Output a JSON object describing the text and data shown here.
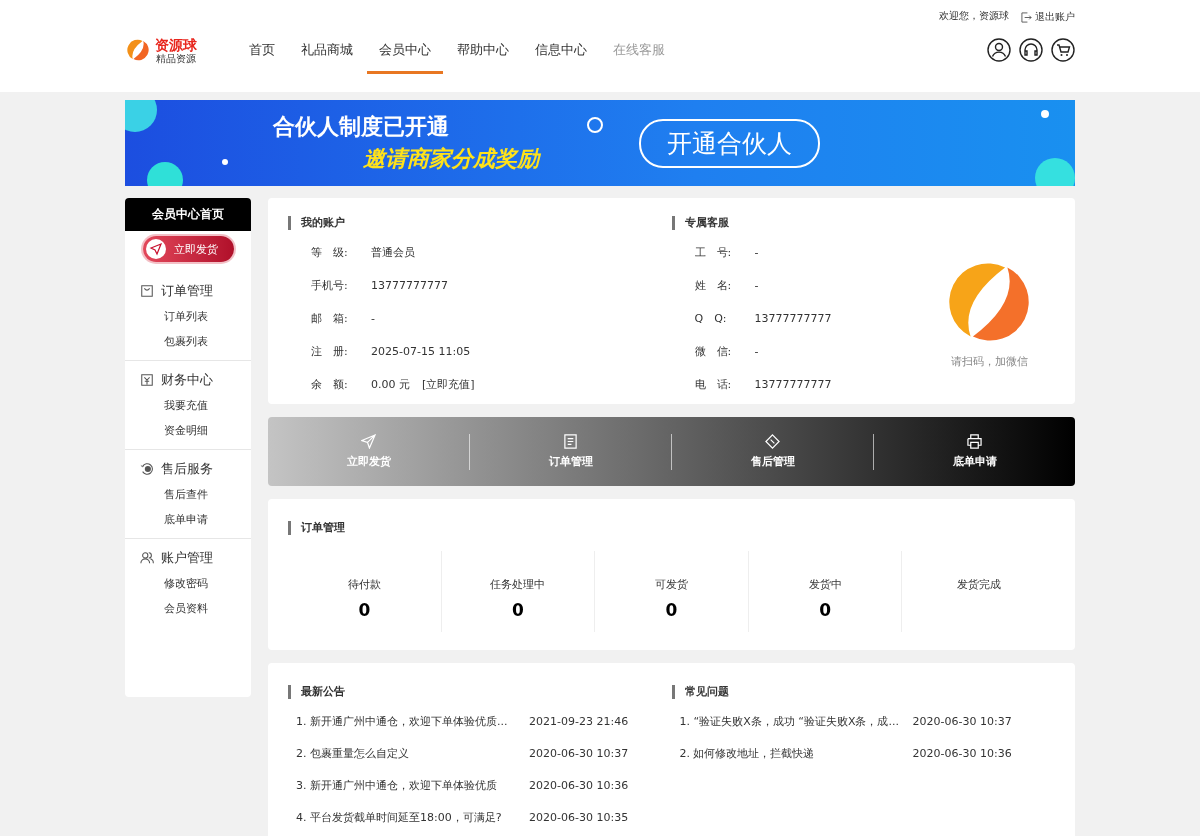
{
  "topbar": {
    "welcome": "欢迎您，资源球",
    "logout": "退出账户"
  },
  "logo": {
    "name": "资源球",
    "tagline": "精品资源"
  },
  "nav": [
    {
      "label": "首页",
      "selected": false,
      "disabled": false
    },
    {
      "label": "礼品商城",
      "selected": false,
      "disabled": false
    },
    {
      "label": "会员中心",
      "selected": true,
      "disabled": false
    },
    {
      "label": "帮助中心",
      "selected": false,
      "disabled": false
    },
    {
      "label": "信息中心",
      "selected": false,
      "disabled": false
    },
    {
      "label": "在线客服",
      "selected": false,
      "disabled": true
    }
  ],
  "banner": {
    "title": "合伙人制度已开通",
    "subtitle": "邀请商家分成奖励",
    "button": "开通合伙人"
  },
  "sidebar": {
    "home": "会员中心首页",
    "ship_button": "立即发货",
    "groups": [
      {
        "kind": "bag",
        "title": "订单管理",
        "items": [
          "订单列表",
          "包裹列表"
        ]
      },
      {
        "kind": "money",
        "title": "财务中心",
        "items": [
          "我要充值",
          "资金明细"
        ]
      },
      {
        "kind": "service",
        "title": "售后服务",
        "items": [
          "售后查件",
          "底单申请"
        ]
      },
      {
        "kind": "users",
        "title": "账户管理",
        "items": [
          "修改密码",
          "会员资料"
        ]
      }
    ]
  },
  "account": {
    "title": "我的账户",
    "rows": [
      {
        "label": "等　级:",
        "value": "普通会员"
      },
      {
        "label": "手机号:",
        "value": "13777777777"
      },
      {
        "label": "邮　箱:",
        "value": "-"
      },
      {
        "label": "注　册:",
        "value": "2025-07-15 11:05"
      },
      {
        "label": "余　额:",
        "value": "0.00 元",
        "link": "[立即充值]"
      }
    ]
  },
  "service": {
    "title": "专属客服",
    "rows": [
      {
        "label": "工　号:",
        "value": "-"
      },
      {
        "label": "姓　名:",
        "value": "-"
      },
      {
        "label": "Q　Q:",
        "value": "13777777777"
      },
      {
        "label": "微　信:",
        "value": "-"
      },
      {
        "label": "电　话:",
        "value": "13777777777"
      }
    ],
    "qr_caption": "请扫码，加微信"
  },
  "quick_actions": [
    {
      "kind": "send",
      "label": "立即发货"
    },
    {
      "kind": "list",
      "label": "订单管理"
    },
    {
      "kind": "tag",
      "label": "售后管理"
    },
    {
      "kind": "print",
      "label": "底单申请"
    }
  ],
  "orders": {
    "title": "订单管理",
    "stats": [
      {
        "label": "待付款",
        "count": "0"
      },
      {
        "label": "任务处理中",
        "count": "0"
      },
      {
        "label": "可发货",
        "count": "0"
      },
      {
        "label": "发货中",
        "count": "0"
      },
      {
        "label": "发货完成"
      }
    ]
  },
  "notices": {
    "title": "最新公告",
    "rows": [
      {
        "text": "1. 新开通广州中通仓，欢迎下单体验优质...",
        "date": "2021-09-23 21:46"
      },
      {
        "text": "2. 包裹重量怎么自定义",
        "date": "2020-06-30 10:37"
      },
      {
        "text": "3. 新开通广州中通仓，欢迎下单体验优质",
        "date": "2020-06-30 10:36"
      },
      {
        "text": "4. 平台发货截单时间延至18:00，可满足?",
        "date": "2020-06-30 10:35"
      }
    ]
  },
  "faq": {
    "title": "常见问题",
    "rows": [
      {
        "text": "1. “验证失败X条，成功 “验证失败X条，成...",
        "date": "2020-06-30 10:37"
      },
      {
        "text": "2. 如何修改地址，拦截快递",
        "date": "2020-06-30 10:36"
      }
    ]
  }
}
